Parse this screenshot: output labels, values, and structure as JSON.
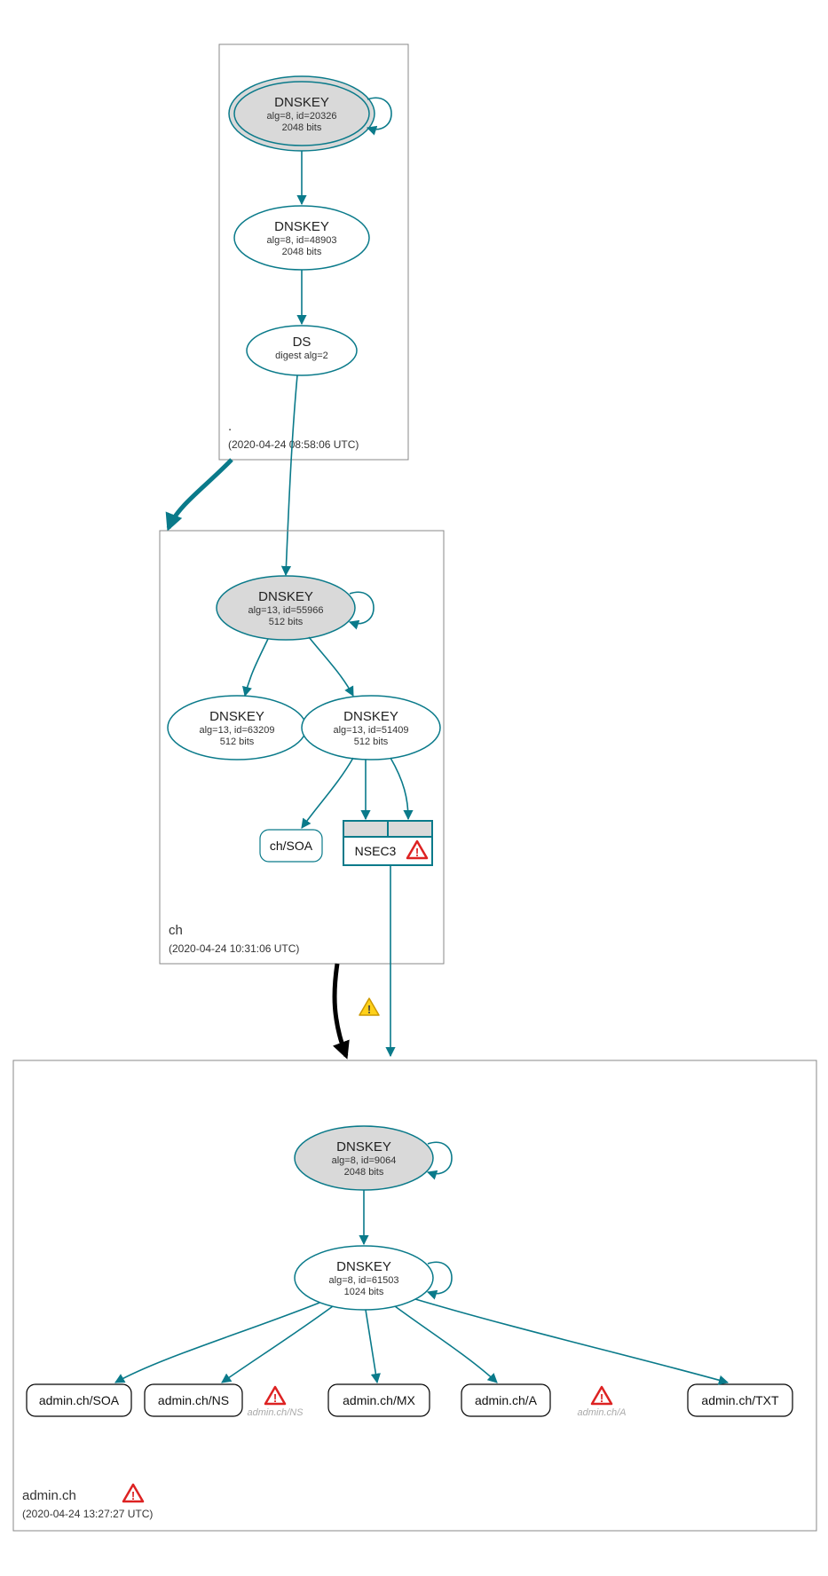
{
  "colors": {
    "teal": "#0a7a8a",
    "gray": "#d9d9d9"
  },
  "zones": {
    "root": {
      "label": ".",
      "timestamp": "(2020-04-24 08:58:06 UTC)"
    },
    "ch": {
      "label": "ch",
      "timestamp": "(2020-04-24 10:31:06 UTC)"
    },
    "admin": {
      "label": "admin.ch",
      "timestamp": "(2020-04-24 13:27:27 UTC)"
    }
  },
  "nodes": {
    "root_ksk": {
      "title": "DNSKEY",
      "sub1": "alg=8, id=20326",
      "sub2": "2048 bits"
    },
    "root_zsk": {
      "title": "DNSKEY",
      "sub1": "alg=8, id=48903",
      "sub2": "2048 bits"
    },
    "root_ds": {
      "title": "DS",
      "sub1": "digest alg=2"
    },
    "ch_ksk": {
      "title": "DNSKEY",
      "sub1": "alg=13, id=55966",
      "sub2": "512 bits"
    },
    "ch_zsk1": {
      "title": "DNSKEY",
      "sub1": "alg=13, id=63209",
      "sub2": "512 bits"
    },
    "ch_zsk2": {
      "title": "DNSKEY",
      "sub1": "alg=13, id=51409",
      "sub2": "512 bits"
    },
    "ch_soa": {
      "label": "ch/SOA"
    },
    "ch_nsec3": {
      "label": "NSEC3"
    },
    "admin_ksk": {
      "title": "DNSKEY",
      "sub1": "alg=8, id=9064",
      "sub2": "2048 bits"
    },
    "admin_zsk": {
      "title": "DNSKEY",
      "sub1": "alg=8, id=61503",
      "sub2": "1024 bits"
    },
    "admin_soa": {
      "label": "admin.ch/SOA"
    },
    "admin_ns": {
      "label": "admin.ch/NS"
    },
    "admin_ns_err": {
      "label": "admin.ch/NS"
    },
    "admin_mx": {
      "label": "admin.ch/MX"
    },
    "admin_a": {
      "label": "admin.ch/A"
    },
    "admin_a_err": {
      "label": "admin.ch/A"
    },
    "admin_txt": {
      "label": "admin.ch/TXT"
    }
  }
}
